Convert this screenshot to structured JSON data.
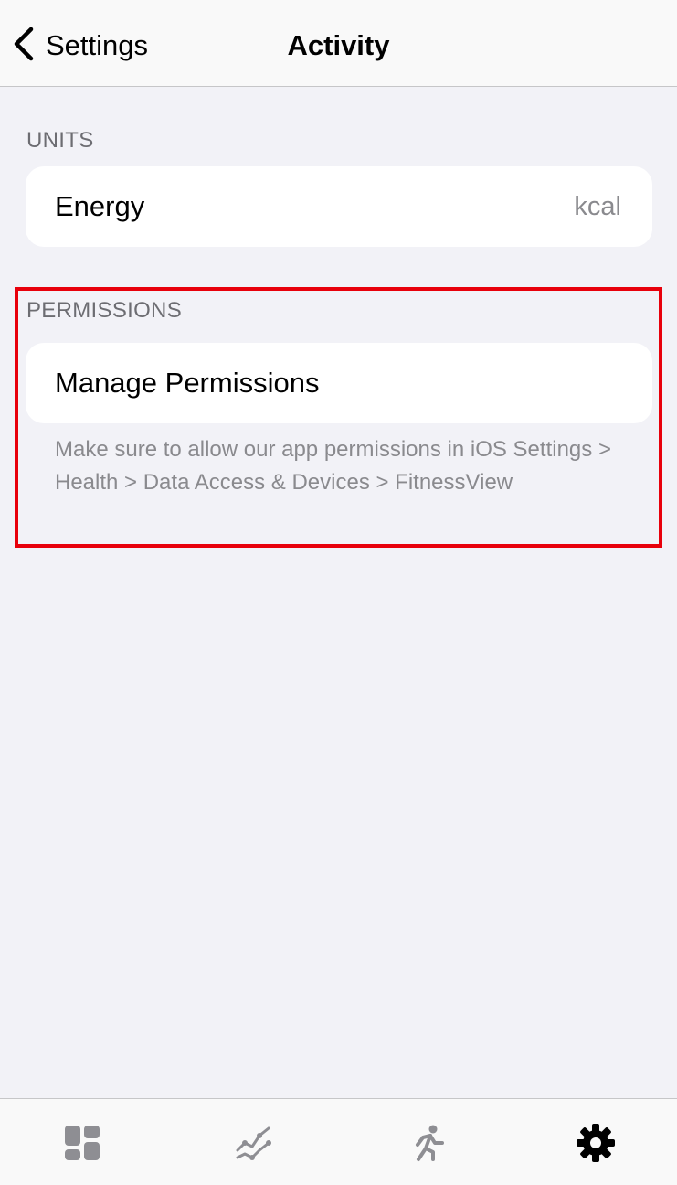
{
  "nav": {
    "back_label": "Settings",
    "title": "Activity"
  },
  "units": {
    "header": "UNITS",
    "energy": {
      "label": "Energy",
      "value": "kcal"
    }
  },
  "permissions": {
    "header": "PERMISSIONS",
    "manage_label": "Manage Permissions",
    "footer": "Make sure to allow our app permissions in iOS Settings > Health > Data Access & Devices > FitnessView"
  },
  "tabbar": {
    "tabs": [
      {
        "icon": "dashboard-icon",
        "color": "#8e8e93"
      },
      {
        "icon": "trend-chart-icon",
        "color": "#8e8e93"
      },
      {
        "icon": "running-icon",
        "color": "#8e8e93"
      },
      {
        "icon": "gear-icon",
        "color": "#000000",
        "selected": true
      }
    ]
  },
  "colors": {
    "background": "#f2f2f7",
    "highlight": "#e8000b",
    "secondary_text": "#8a8a8e"
  }
}
